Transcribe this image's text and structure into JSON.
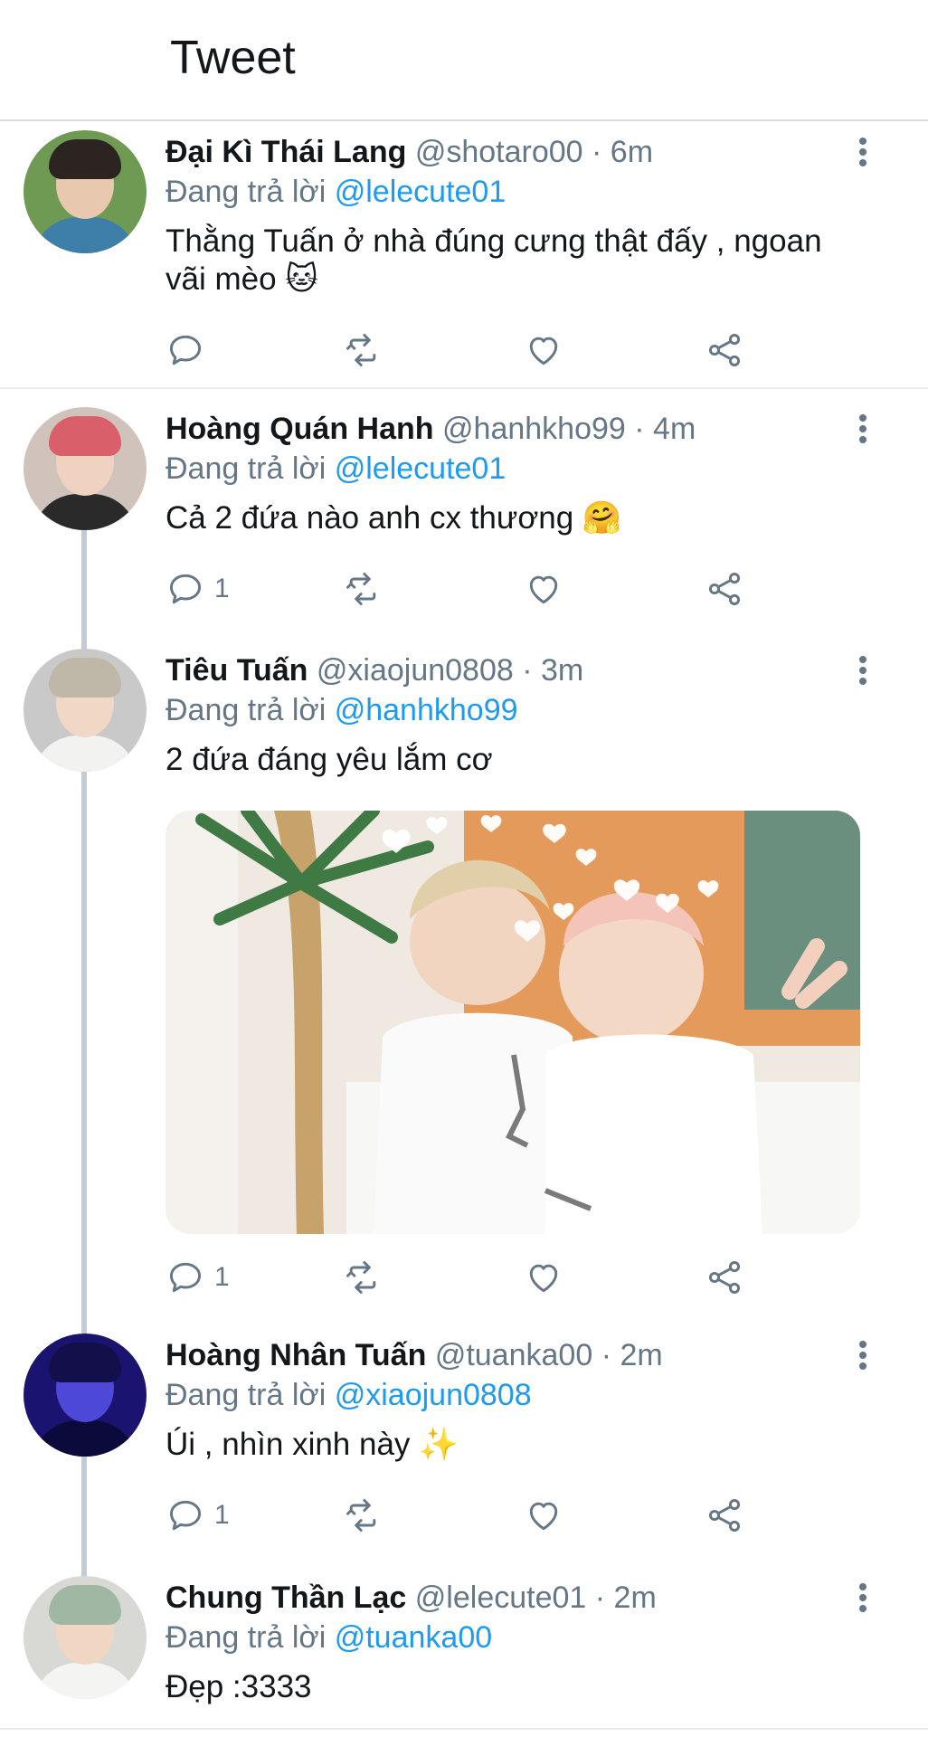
{
  "header": {
    "title": "Tweet"
  },
  "tweets": [
    {
      "name": "Đại Kì Thái Lang",
      "handle": "@shotaro00",
      "separator": "·",
      "time": "6m",
      "reply_prefix": "Đang trả lời",
      "reply_to": "@lelecute01",
      "text_line1": "Thằng Tuấn ở nhà đúng cưng thật đấy , ngoan",
      "text_line2": "vãi mèo 🐱",
      "reply_count": ""
    },
    {
      "name": "Hoàng Quán Hanh",
      "handle": "@hanhkho99",
      "separator": "·",
      "time": "4m",
      "reply_prefix": "Đang trả lời",
      "reply_to": "@lelecute01",
      "text_line1": "Cả 2 đứa nào anh cx thương 🤗",
      "reply_count": "1"
    },
    {
      "name": "Tiêu Tuấn",
      "handle": "@xiaojun0808",
      "separator": "·",
      "time": "3m",
      "reply_prefix": "Đang trả lời",
      "reply_to": "@hanhkho99",
      "text_line1": "2 đứa đáng yêu lắm cơ",
      "reply_count": "1"
    },
    {
      "name": "Hoàng Nhân Tuấn",
      "handle": "@tuanka00",
      "separator": "·",
      "time": "2m",
      "reply_prefix": "Đang trả lời",
      "reply_to": "@xiaojun0808",
      "text_line1": "Úi , nhìn xinh này ✨",
      "reply_count": "1"
    },
    {
      "name": "Chung Thần Lạc",
      "handle": "@lelecute01",
      "separator": "·",
      "time": "2m",
      "reply_prefix": "Đang trả lời",
      "reply_to": "@tuanka00",
      "text_line1": "Đẹp :3333"
    }
  ],
  "icons": {
    "reply": "reply-icon",
    "retweet": "retweet-icon",
    "like": "heart-icon",
    "share": "share-icon",
    "more": "more-vertical-icon"
  },
  "colors": {
    "link": "#1d9bf0",
    "secondary": "#657786",
    "text": "#14171a",
    "thread_line": "#c4ccd3"
  }
}
